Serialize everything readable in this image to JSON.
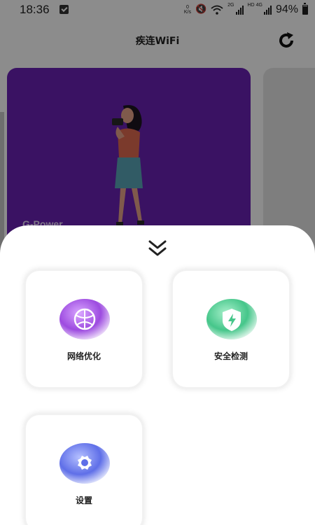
{
  "status_bar": {
    "time": "18:36",
    "speed_value": "0",
    "speed_unit": "K/s",
    "net_label_1": "2G",
    "net_label_2": "HD",
    "net_label_3": "4G",
    "battery_percent": "94%"
  },
  "header": {
    "title": "疾连WiFi",
    "refresh_icon": "refresh-icon"
  },
  "banner": {
    "caption": "G-Power",
    "background_color": "#6a22b4"
  },
  "sheet": {
    "collapse_icon": "double-chevron-down-icon",
    "items": [
      {
        "label": "网络优化",
        "icon": "globe-icon",
        "color": "#a25be0"
      },
      {
        "label": "安全检测",
        "icon": "shield-bolt-icon",
        "color": "#57d19a"
      },
      {
        "label": "设置",
        "icon": "gear-icon",
        "color": "#6f7ff0"
      }
    ]
  }
}
